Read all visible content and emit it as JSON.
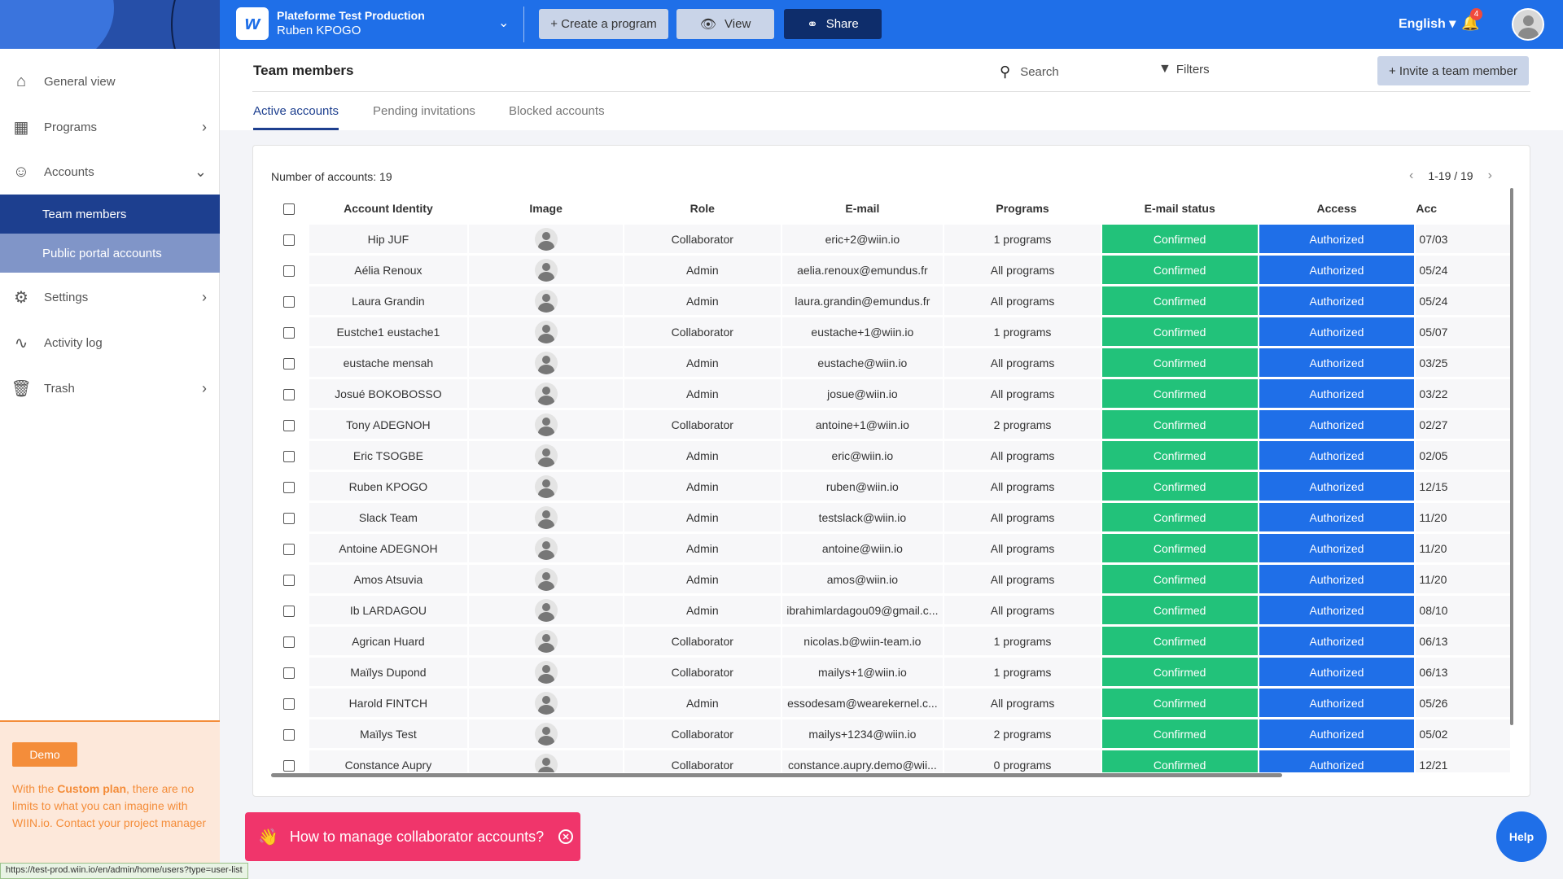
{
  "header": {
    "platform_name": "Plateforme Test Production",
    "user_name": "Ruben KPOGO",
    "create_program": "+ Create a program",
    "view": "View",
    "share": "Share",
    "language": "English ▾",
    "notification_count": "4",
    "brand_letter": "w"
  },
  "sidebar": {
    "items": [
      {
        "label": "General view",
        "icon": "home-icon"
      },
      {
        "label": "Programs",
        "icon": "grid-icon"
      },
      {
        "label": "Accounts",
        "icon": "user-circle-icon"
      },
      {
        "label": "Team members"
      },
      {
        "label": "Public portal accounts"
      },
      {
        "label": "Settings",
        "icon": "gear-icon"
      },
      {
        "label": "Activity log",
        "icon": "activity-icon"
      },
      {
        "label": "Trash",
        "icon": "trash-icon"
      }
    ],
    "demo_label": "Demo",
    "promo_prefix": "With the ",
    "promo_plan": "Custom plan",
    "promo_suffix": ", there are no limits to what you can imagine with WIIN.io. Contact your project manager",
    "status_url": "https://test-prod.wiin.io/en/admin/home/users?type=user-list"
  },
  "main": {
    "title": "Team members",
    "search_label": "Search",
    "filters_label": "Filters",
    "invite_label": "+ Invite a team member",
    "tabs": [
      "Active accounts",
      "Pending invitations",
      "Blocked accounts"
    ],
    "count_label": "Number of accounts: 19",
    "pager": "1-19 / 19"
  },
  "table": {
    "columns": [
      "Account Identity",
      "Image",
      "Role",
      "E-mail",
      "Programs",
      "E-mail status",
      "Access",
      "Acc"
    ],
    "rows": [
      {
        "name": "Hip JUF",
        "role": "Collaborator",
        "email": "eric+2@wiin.io",
        "programs": "1 programs",
        "status": "Confirmed",
        "access": "Authorized",
        "last": "07/03"
      },
      {
        "name": "Aélia Renoux",
        "role": "Admin",
        "email": "aelia.renoux@emundus.fr",
        "programs": "All programs",
        "status": "Confirmed",
        "access": "Authorized",
        "last": "05/24"
      },
      {
        "name": "Laura Grandin",
        "role": "Admin",
        "email": "laura.grandin@emundus.fr",
        "programs": "All programs",
        "status": "Confirmed",
        "access": "Authorized",
        "last": "05/24"
      },
      {
        "name": "Eustche1 eustache1",
        "role": "Collaborator",
        "email": "eustache+1@wiin.io",
        "programs": "1 programs",
        "status": "Confirmed",
        "access": "Authorized",
        "last": "05/07"
      },
      {
        "name": "eustache mensah",
        "role": "Admin",
        "email": "eustache@wiin.io",
        "programs": "All programs",
        "status": "Confirmed",
        "access": "Authorized",
        "last": "03/25"
      },
      {
        "name": "Josué BOKOBOSSO",
        "role": "Admin",
        "email": "josue@wiin.io",
        "programs": "All programs",
        "status": "Confirmed",
        "access": "Authorized",
        "last": "03/22"
      },
      {
        "name": "Tony ADEGNOH",
        "role": "Collaborator",
        "email": "antoine+1@wiin.io",
        "programs": "2 programs",
        "status": "Confirmed",
        "access": "Authorized",
        "last": "02/27"
      },
      {
        "name": "Eric TSOGBE",
        "role": "Admin",
        "email": "eric@wiin.io",
        "programs": "All programs",
        "status": "Confirmed",
        "access": "Authorized",
        "last": "02/05"
      },
      {
        "name": "Ruben KPOGO",
        "role": "Admin",
        "email": "ruben@wiin.io",
        "programs": "All programs",
        "status": "Confirmed",
        "access": "Authorized",
        "last": "12/15"
      },
      {
        "name": "Slack Team",
        "role": "Admin",
        "email": "testslack@wiin.io",
        "programs": "All programs",
        "status": "Confirmed",
        "access": "Authorized",
        "last": "11/20"
      },
      {
        "name": "Antoine ADEGNOH",
        "role": "Admin",
        "email": "antoine@wiin.io",
        "programs": "All programs",
        "status": "Confirmed",
        "access": "Authorized",
        "last": "11/20"
      },
      {
        "name": "Amos Atsuvia",
        "role": "Admin",
        "email": "amos@wiin.io",
        "programs": "All programs",
        "status": "Confirmed",
        "access": "Authorized",
        "last": "11/20"
      },
      {
        "name": "Ib LARDAGOU",
        "role": "Admin",
        "email": "ibrahimlardagou09@gmail.c...",
        "programs": "All programs",
        "status": "Confirmed",
        "access": "Authorized",
        "last": "08/10"
      },
      {
        "name": "Agrican Huard",
        "role": "Collaborator",
        "email": "nicolas.b@wiin-team.io",
        "programs": "1 programs",
        "status": "Confirmed",
        "access": "Authorized",
        "last": "06/13"
      },
      {
        "name": "Maïlys Dupond",
        "role": "Collaborator",
        "email": "mailys+1@wiin.io",
        "programs": "1 programs",
        "status": "Confirmed",
        "access": "Authorized",
        "last": "06/13"
      },
      {
        "name": "Harold FINTCH",
        "role": "Admin",
        "email": "essodesam@wearekernel.c...",
        "programs": "All programs",
        "status": "Confirmed",
        "access": "Authorized",
        "last": "05/26"
      },
      {
        "name": "Maïlys Test",
        "role": "Collaborator",
        "email": "mailys+1234@wiin.io",
        "programs": "2 programs",
        "status": "Confirmed",
        "access": "Authorized",
        "last": "05/02"
      },
      {
        "name": "Constance Aupry",
        "role": "Collaborator",
        "email": "constance.aupry.demo@wii...",
        "programs": "0 programs",
        "status": "Confirmed",
        "access": "Authorized",
        "last": "12/21"
      }
    ]
  },
  "toast": {
    "text": "How to manage collaborator accounts?",
    "emoji": "👋"
  },
  "help_label": "Help",
  "colors": {
    "topbar": "#1f6fe8",
    "confirmed": "#22c27a",
    "authorized": "#1f6fe8",
    "sidebar_active": "#1d3f8f",
    "toast": "#f0356b",
    "promo": "#f48d3a"
  }
}
